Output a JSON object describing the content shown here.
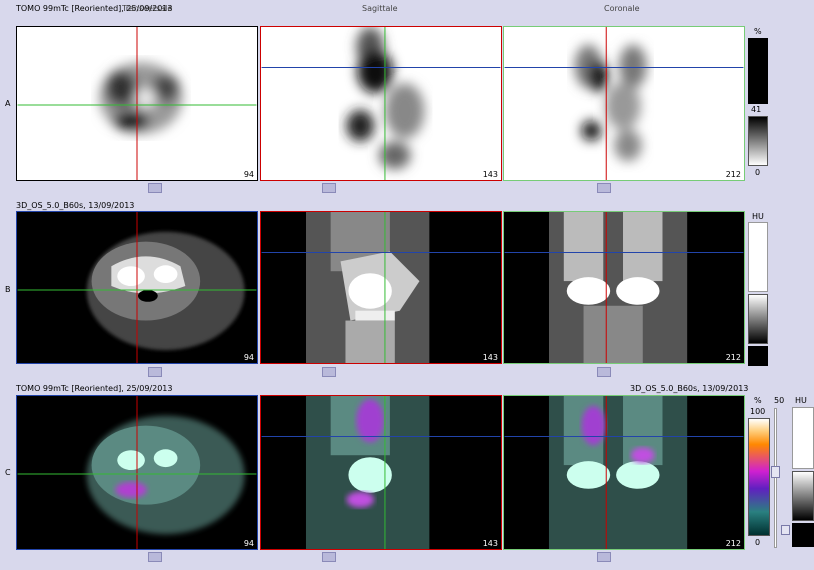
{
  "header": {
    "row_a_title": "TOMO 99mTc [Reoriented], 25/09/2013",
    "col_transversale": "Transversale",
    "col_sagittale": "Sagittale",
    "col_coronale": "Coronale"
  },
  "rows": {
    "a_label": "A",
    "b_label": "B",
    "c_label": "C",
    "b_title": "3D_OS_5.0_B60s, 13/09/2013",
    "c_title_left": "TOMO 99mTc [Reoriented], 25/09/2013",
    "c_title_right": "3D_OS_5.0_B60s, 13/09/2013"
  },
  "slices": {
    "transversale": "94",
    "sagittale": "143",
    "coronale": "212"
  },
  "colorbars": {
    "a_unit": "%",
    "a_max": "41",
    "a_min": "0",
    "b_unit": "HU",
    "c_unit": "%",
    "c_max": "100",
    "c_min": "0",
    "c_slider_value": "50",
    "c_hu_unit": "HU"
  }
}
